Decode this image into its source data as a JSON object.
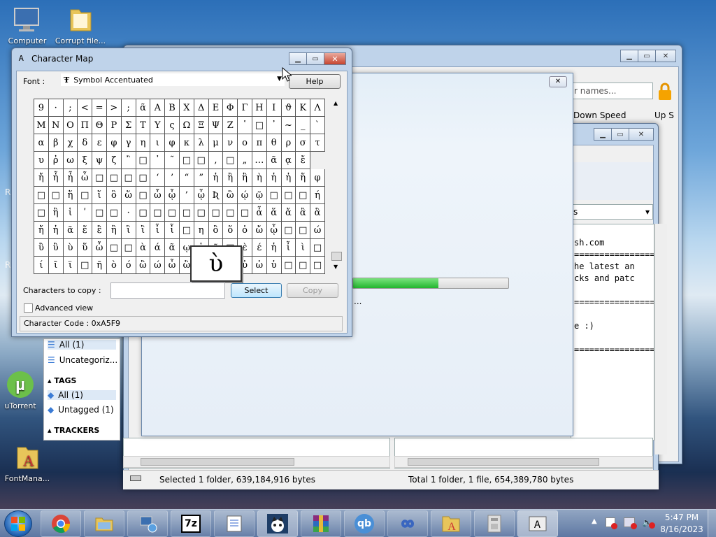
{
  "desktop": {
    "icons": [
      {
        "label": "Computer",
        "icon": "computer-icon"
      },
      {
        "label": "Corrupt file...",
        "icon": "folder-icon"
      },
      {
        "label": "uTorrent",
        "icon": "utorrent-icon"
      },
      {
        "label": "FontMana...",
        "icon": "fontmanager-icon"
      }
    ],
    "side_letters": [
      "R",
      "R"
    ]
  },
  "charmap": {
    "title": "Character Map",
    "font_label": "Font :",
    "font_value": "Symbol Accentuated",
    "help": "Help",
    "grid": [
      [
        "9",
        "·",
        ";",
        "<",
        "=",
        ">",
        ";",
        "ᾶ",
        "Α",
        "Β",
        "Χ",
        "Δ",
        "Ε",
        "Φ",
        "Γ",
        "Η",
        "Ι",
        "ϑ",
        "Κ",
        "Λ"
      ],
      [
        "Μ",
        "Ν",
        "Ο",
        "Π",
        "Θ",
        "Ρ",
        "Σ",
        "Τ",
        "Υ",
        "ς",
        "Ω",
        "Ξ",
        "Ψ",
        "Ζ",
        "῾",
        "□",
        "᾽",
        "~",
        "_",
        "`"
      ],
      [
        "α",
        "β",
        "χ",
        "δ",
        "ε",
        "φ",
        "γ",
        "η",
        "ι",
        "φ",
        "κ",
        "λ",
        "μ",
        "ν",
        "ο",
        "π",
        "θ",
        "ρ",
        "σ",
        "τ"
      ],
      [
        "υ",
        "ῤ",
        "ω",
        "ξ",
        "ψ",
        "ζ",
        "῍",
        "□",
        "᾿",
        "῀",
        "□",
        "□",
        ",",
        "□",
        "„",
        "…",
        "ᾶ",
        "ᾳ",
        "ἔ"
      ],
      [
        "ἤ",
        "ἧ",
        "ἦ",
        "ὦ",
        "□",
        "□",
        "□",
        "□",
        "‘",
        "’",
        "“",
        "”",
        "ἡ",
        "ἢ",
        "ἣ",
        "ὴ",
        "ἡ",
        "ἠ",
        "ἥ",
        "φ"
      ],
      [
        "□",
        "□",
        "ἥ",
        "□",
        "ἵ",
        "ὃ",
        "ὥ",
        "□",
        "ὧ",
        "ᾧ",
        "’",
        "ᾧ",
        "Ʀ",
        "ὣ",
        "ῴ",
        "ῷ",
        "□",
        "□",
        "□",
        "ή"
      ],
      [
        "□",
        "ἢ",
        "ἱ",
        "ʹ",
        "□",
        "□",
        "·",
        "□",
        "□",
        "□",
        "□",
        "□",
        "□",
        "□",
        "□",
        "ἆ",
        "ἅ",
        "ἄ",
        "ἂ",
        "ἃ"
      ],
      [
        "ἤ",
        "ἡ",
        "ᾶ",
        "ἕ",
        "ἓ",
        "ἣ",
        "ἳ",
        "ἲ",
        "ἷ",
        "ἶ",
        "□",
        "η",
        "ὂ",
        "ὅ",
        "ὁ",
        "ὤ",
        "ᾦ",
        "□",
        "□",
        "ώ"
      ],
      [
        "ὓ",
        "ὒ",
        "ὺ",
        "ὕ",
        "ὦ",
        "□",
        "□",
        "ὰ",
        "ά",
        "ᾶ",
        "ῳ",
        "ὑ",
        "ῷ",
        "□",
        "ὲ",
        "έ",
        "ἡ",
        "ἶ",
        "ὶ",
        "□"
      ],
      [
        "ί",
        "ῖ",
        "ϊ",
        "□",
        "ῆ",
        "ὸ",
        "ό",
        "ὣ",
        "ώ",
        "ὦ",
        "ὢ",
        "ὣ",
        "ὦ",
        "ὔ",
        "ὐ",
        "ὠ",
        "ὑ",
        "□",
        "□",
        "□"
      ]
    ],
    "magnified": "ὺ",
    "chars_to_copy_label": "Characters to copy :",
    "chars_to_copy_value": "",
    "select": "Select",
    "copy": "Copy",
    "advanced_view": "Advanced view",
    "status": "Character Code : 0xA5F9"
  },
  "qbittorrent": {
    "search_placeholder": "...",
    "search_value": "r names...",
    "column_down_speed": "Down Speed",
    "column_up_speed": "Up S",
    "sidebar": {
      "items_top": [
        {
          "label": "All (1)"
        },
        {
          "label": "Uncategoriz..."
        }
      ],
      "tags_header": "TAGS",
      "tags": [
        {
          "label": "All (1)"
        },
        {
          "label": "Untagged (1)"
        }
      ],
      "trackers_header": "TRACKERS"
    },
    "log_lines": [
      "sh.com",
      "=================",
      "he latest an",
      "cks and patc",
      "=================",
      "e :)",
      "================="
    ]
  },
  "progress": {
    "fraction": 0.55,
    "text": "..."
  },
  "seven_zip": {
    "status_left": "Selected 1 folder, 639,184,916 bytes",
    "status_right": "Total 1 folder, 1 file, 654,389,780 bytes"
  },
  "taskbar": {
    "items": [
      "chrome-icon",
      "explorer-icon",
      "network-icon",
      "7zip-icon",
      "notepad-icon",
      "cat-app-icon",
      "winrar-icon",
      "qbittorrent-icon",
      "infinity-icon",
      "fontmanager-icon",
      "archive-icon",
      "charmap-icon"
    ],
    "qb_label": "qb",
    "zip_label": "7z",
    "time": "5:47 PM",
    "date": "8/16/2023"
  },
  "colors": {
    "accent_green": "#2fc43a",
    "selection_blue": "#cfe3f6"
  }
}
